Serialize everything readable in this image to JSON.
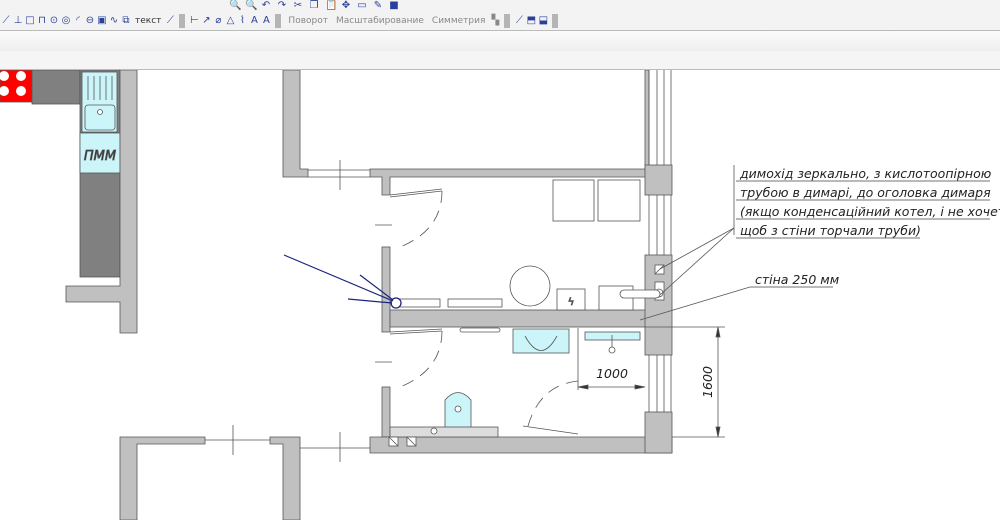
{
  "toolbar_top": {
    "icons": [
      "zoom-out-icon",
      "zoom-in-icon",
      "undo-icon",
      "redo-icon",
      "cut-icon",
      "copy-icon",
      "paste-icon",
      "pan-icon",
      "window-icon",
      "properties-icon",
      "save-icon"
    ]
  },
  "toolbar_main": {
    "draw_icons": [
      "line-icon",
      "perpendicular-icon",
      "rectangle-icon",
      "polyline-icon",
      "circle-icon",
      "circle-tangent-icon",
      "arc-icon",
      "ellipse-icon",
      "region-icon",
      "spline-icon",
      "copy-object-icon"
    ],
    "text_label": "текст",
    "dimension_icons": [
      "linear-dimension-icon",
      "radial-dimension-icon",
      "diameter-dimension-icon",
      "angle-dimension-icon",
      "leader-icon",
      "text-style-icon",
      "text-format-icon"
    ],
    "rotate_label": "Поворот",
    "scale_label": "Масштабирование",
    "mirror_label": "Симметрия",
    "extra_icons": [
      "trim-icon",
      "layer-up-icon",
      "layer-down-icon"
    ]
  },
  "drawing": {
    "appliance_label": "ПММ",
    "note_flue": [
      "димохід зеркально, з кислотоопірною",
      "трубою в димарі, до оголовка димаря",
      "(якщо конденсаційний котел, і не хочете",
      "щоб з стіни торчали труби)"
    ],
    "note_wall": "стіна 250 мм",
    "dim_width": "1000",
    "dim_height": "1600",
    "colors": {
      "wall": "#c0c0c0",
      "counter": "#808080",
      "stove": "#ff0000",
      "fixture": "#ccf5fa",
      "arrow": "#1a237e"
    }
  }
}
